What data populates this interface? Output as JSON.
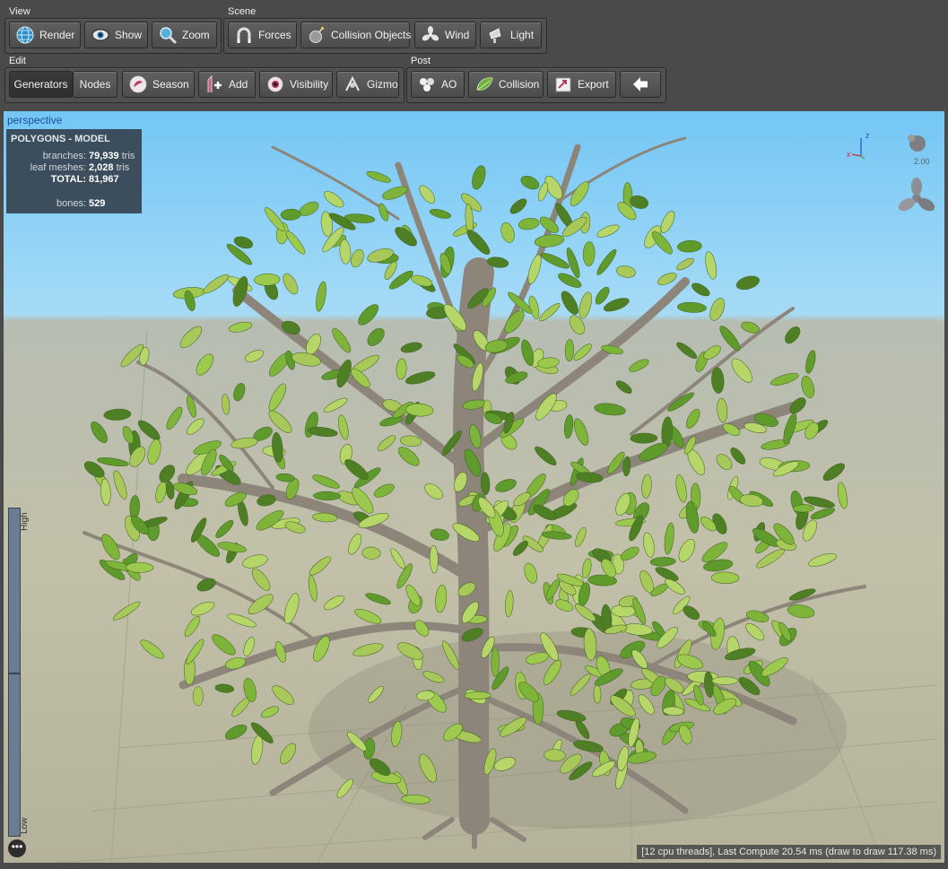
{
  "toolbar": {
    "view": {
      "label": "View",
      "buttons": [
        {
          "label": "Render",
          "icon": "globe-icon"
        },
        {
          "label": "Show",
          "icon": "eye-icon"
        },
        {
          "label": "Zoom",
          "icon": "magnifier-icon"
        }
      ]
    },
    "scene": {
      "label": "Scene",
      "buttons": [
        {
          "label": "Forces",
          "icon": "magnet-icon"
        },
        {
          "label": "Collision Objects",
          "icon": "bomb-icon"
        },
        {
          "label": "Wind",
          "icon": "fan-icon"
        },
        {
          "label": "Light",
          "icon": "spotlight-icon"
        }
      ]
    },
    "edit": {
      "label": "Edit",
      "buttons": [
        {
          "label": "Generators"
        },
        {
          "label": "Nodes"
        },
        {
          "label": "Season",
          "icon": "season-icon"
        },
        {
          "label": "Add",
          "icon": "add-icon"
        },
        {
          "label": "Visibility",
          "icon": "eye-ball-icon"
        },
        {
          "label": "Gizmo",
          "icon": "gizmo-icon"
        }
      ]
    },
    "post": {
      "label": "Post",
      "buttons": [
        {
          "label": "AO",
          "icon": "spheres-icon"
        },
        {
          "label": "Collision",
          "icon": "leaf-icon"
        },
        {
          "label": "Export",
          "icon": "export-icon"
        },
        {
          "label": "",
          "icon": "arrow-left-icon"
        }
      ]
    }
  },
  "viewport": {
    "title": "perspective",
    "stats": {
      "heading": "POLYGONS - MODEL",
      "branches_label": "branches:",
      "branches_value": "79,939",
      "branches_unit": "tris",
      "leaf_label": "leaf meshes:",
      "leaf_value": "2,028",
      "leaf_unit": "tris",
      "total_label": "TOTAL:",
      "total_value": "81,967",
      "bones_label": "bones:",
      "bones_value": "529"
    },
    "camera_speed": "2.00",
    "axis_labels": {
      "z": "z",
      "x": "x"
    },
    "lod": {
      "high": "High",
      "low": "Low"
    },
    "status": "[12 cpu threads], Last Compute 20.54 ms (draw to draw 117.38 ms)",
    "more_icon": "ellipsis-icon"
  },
  "colors": {
    "toolbar_bg": "#4a4a4a",
    "sky_top": "#73c6f5",
    "ground": "#c2c0a8",
    "stats_bg": "#34404c",
    "title_blue": "#1c4e9c",
    "leaf_green": "#7fb43a",
    "bark": "#8d857a"
  }
}
